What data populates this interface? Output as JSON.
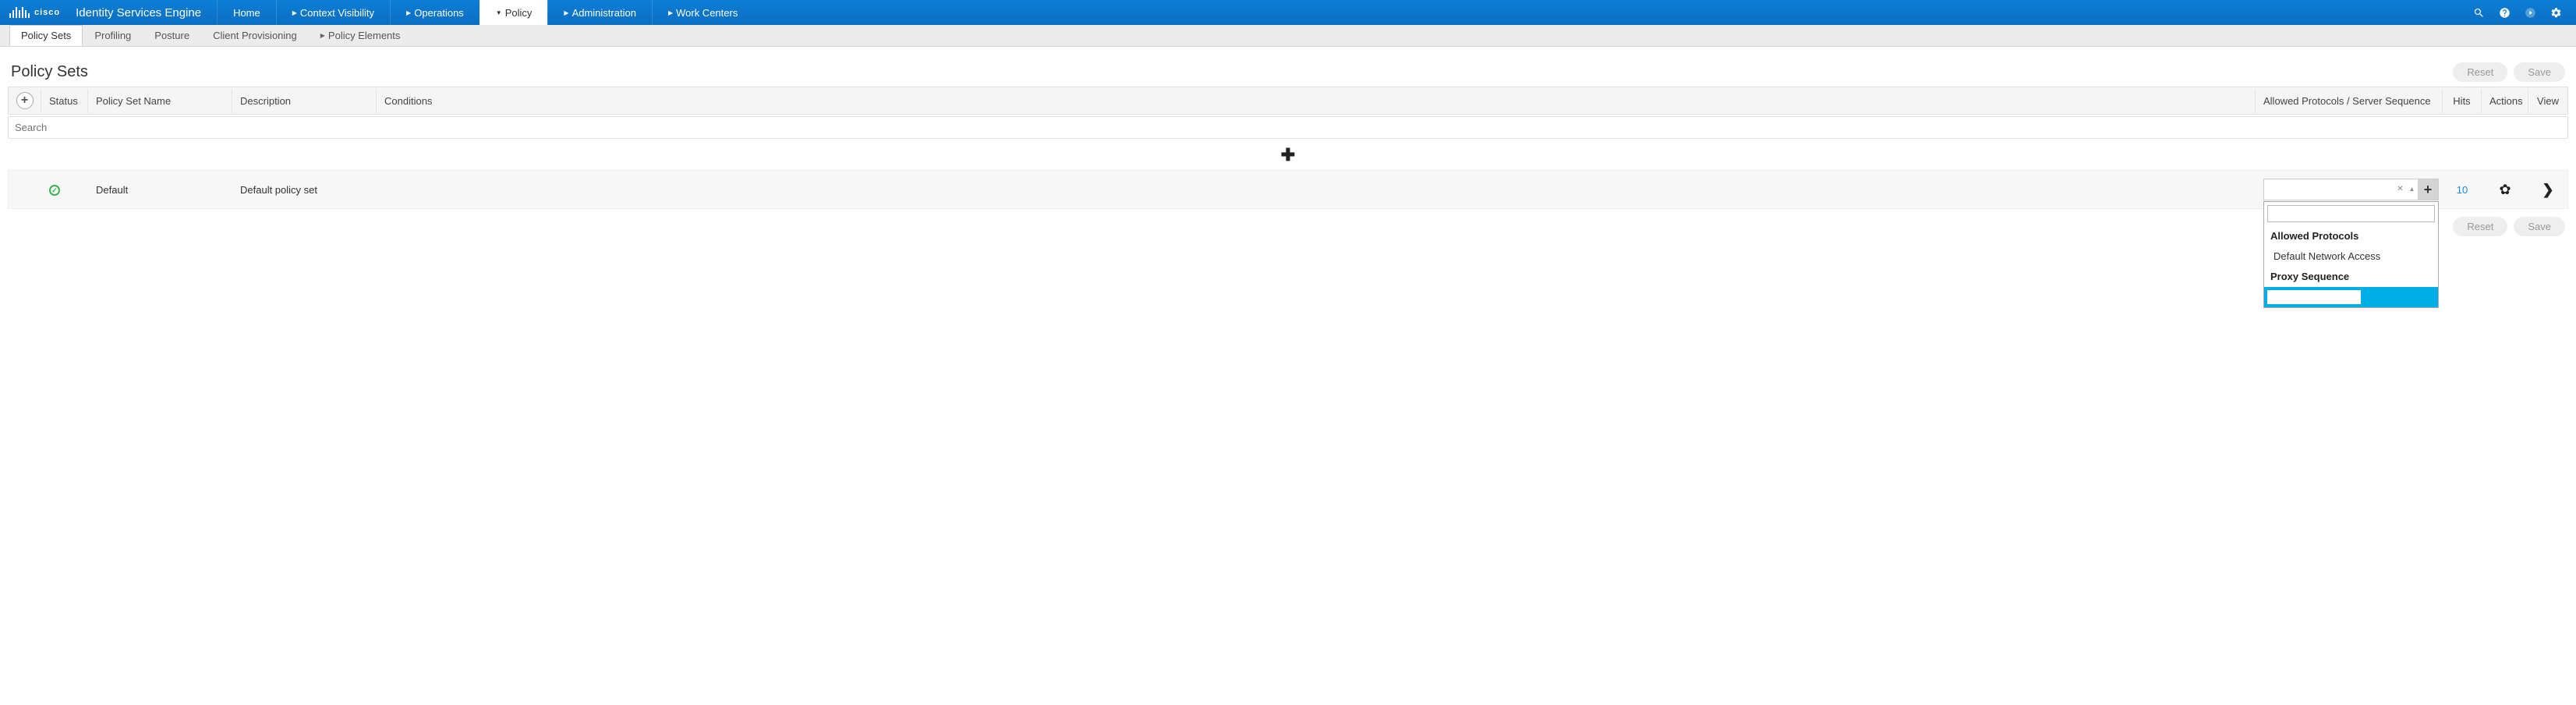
{
  "brand": {
    "logo_text": "cisco",
    "app_title": "Identity Services Engine"
  },
  "main_nav": {
    "home": "Home",
    "context": "Context Visibility",
    "operations": "Operations",
    "policy": "Policy",
    "admin": "Administration",
    "work": "Work Centers"
  },
  "sub_nav": {
    "policy_sets": "Policy Sets",
    "profiling": "Profiling",
    "posture": "Posture",
    "client_prov": "Client Provisioning",
    "policy_elements": "Policy Elements"
  },
  "page": {
    "title": "Policy Sets",
    "reset": "Reset",
    "save": "Save"
  },
  "columns": {
    "status": "Status",
    "name": "Policy Set Name",
    "description": "Description",
    "conditions": "Conditions",
    "protocols": "Allowed Protocols / Server Sequence",
    "hits": "Hits",
    "actions": "Actions",
    "view": "View"
  },
  "search": {
    "placeholder": "Search"
  },
  "row": {
    "name": "Default",
    "description": "Default policy set",
    "hits": "10"
  },
  "dropdown": {
    "section1": "Allowed Protocols",
    "item1": "Default Network Access",
    "section2": "Proxy Sequence"
  }
}
